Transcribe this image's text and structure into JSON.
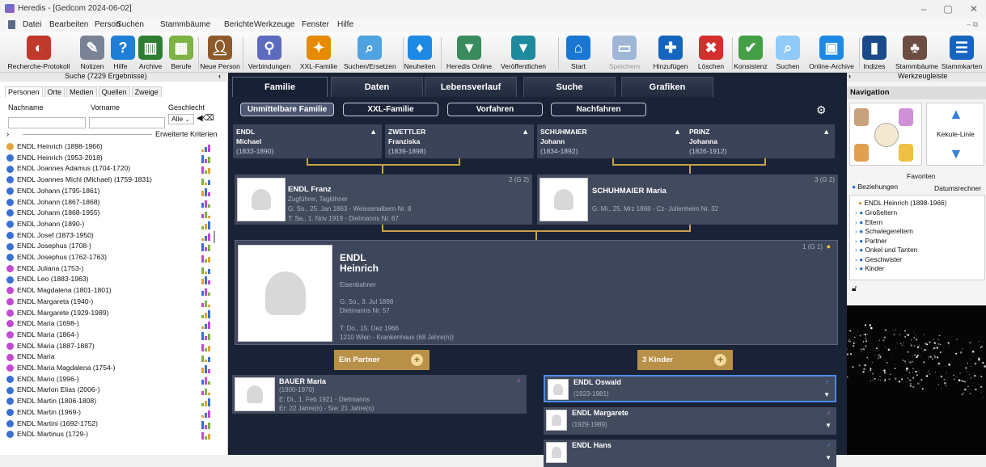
{
  "window": {
    "title": "Heredis - [Gedcom 2024-06-02]"
  },
  "menu": [
    "Datei",
    "Bearbeiten",
    "Person",
    "Suchen",
    "Stammbäume",
    "Berichte",
    "Werkzeuge",
    "Fenster",
    "Hilfe"
  ],
  "toolbar": [
    {
      "label": "Recherche-Protokoll",
      "icon": "research-log-icon",
      "color": "#c0392b"
    },
    {
      "label": "Notizen",
      "icon": "notes-icon",
      "color": "#7a8296"
    },
    {
      "label": "Hilfe",
      "icon": "help-icon",
      "color": "#1f7fd6"
    },
    {
      "label": "Archive",
      "icon": "archive-icon",
      "color": "#2e7d32"
    },
    {
      "label": "Berufe",
      "icon": "professions-icon",
      "color": "#7cb342"
    },
    {
      "label": "Neue Person",
      "icon": "new-person-icon",
      "color": "#8d5a2b"
    },
    {
      "label": "Verbindungen",
      "icon": "connections-icon",
      "color": "#5c6bc0"
    },
    {
      "label": "XXL-Familie",
      "icon": "xxl-family-icon",
      "color": "#e68a00"
    },
    {
      "label": "Suchen/Ersetzen",
      "icon": "search-replace-icon",
      "color": "#4fa3e0"
    },
    {
      "label": "Neuheiten",
      "icon": "news-icon",
      "color": "#1e88e5"
    },
    {
      "label": "Heredis Online",
      "icon": "heredis-online-icon",
      "color": "#3a8b5e"
    },
    {
      "label": "Veröffentlichen",
      "icon": "publish-icon",
      "color": "#1f8a9e"
    },
    {
      "label": "Start",
      "icon": "home-icon",
      "color": "#1976d2"
    },
    {
      "label": "Speichern",
      "icon": "save-icon",
      "color": "#9fb7d6"
    },
    {
      "label": "Hinzufügen",
      "icon": "add-icon",
      "color": "#1565c0"
    },
    {
      "label": "Löschen",
      "icon": "delete-icon",
      "color": "#d32f2f"
    },
    {
      "label": "Konsistenz",
      "icon": "consistency-icon",
      "color": "#43a047"
    },
    {
      "label": "Suchen",
      "icon": "search-icon",
      "color": "#90caf9"
    },
    {
      "label": "Online-Archive",
      "icon": "online-archives-icon",
      "color": "#1e88e5"
    },
    {
      "label": "Indizes",
      "icon": "indexes-icon",
      "color": "#1a4a8a"
    },
    {
      "label": "Stammbäume",
      "icon": "family-tree-icon",
      "color": "#6d4c41"
    },
    {
      "label": "Stammkarten",
      "icon": "family-cards-icon",
      "color": "#1565c0"
    }
  ],
  "subbar": {
    "search_result": "Suche (7229 Ergebnisse)",
    "toolbox": "Werkzeugleiste"
  },
  "leftpanel": {
    "tabs": [
      "Personen",
      "Orte",
      "Medien",
      "Quellen",
      "Zweige"
    ],
    "labels": {
      "lastname": "Nachname",
      "firstname": "Vorname",
      "gender": "Geschlecht",
      "gender_value": "Alle",
      "advanced": "Erweiterte Kriterien"
    },
    "persons": [
      {
        "name": "ENDL Heinrich (1898-1966)",
        "g": "m",
        "sel": true
      },
      {
        "name": "ENDL Heinrich (1953-2018)",
        "g": "m"
      },
      {
        "name": "ENDL Joannes Adamus (1704-1720)",
        "g": "m"
      },
      {
        "name": "ENDL Joannes Michl (Michael) (1759-1831)",
        "g": "m"
      },
      {
        "name": "ENDL Johann (1795-1861)",
        "g": "m"
      },
      {
        "name": "ENDL Johann (1867-1868)",
        "g": "m"
      },
      {
        "name": "ENDL Johann (1868-1955)",
        "g": "m"
      },
      {
        "name": "ENDL Johann (1890-)",
        "g": "m"
      },
      {
        "name": "ENDL Josef (1873-1950)",
        "g": "m"
      },
      {
        "name": "ENDL Josephus (1708-)",
        "g": "m"
      },
      {
        "name": "ENDL Josephus (1762-1763)",
        "g": "m"
      },
      {
        "name": "ENDL Juliana (1753-)",
        "g": "f"
      },
      {
        "name": "ENDL Leo (1883-1963)",
        "g": "m"
      },
      {
        "name": "ENDL Magdalena (1801-1801)",
        "g": "f"
      },
      {
        "name": "ENDL Margareta (1940-)",
        "g": "f"
      },
      {
        "name": "ENDL Margarete (1929-1989)",
        "g": "f"
      },
      {
        "name": "ENDL Maria (1698-)",
        "g": "f"
      },
      {
        "name": "ENDL Maria (1864-)",
        "g": "f"
      },
      {
        "name": "ENDL Maria (1887-1887)",
        "g": "f"
      },
      {
        "name": "ENDL Maria",
        "g": "f"
      },
      {
        "name": "ENDL Maria Magdalena (1754-)",
        "g": "f"
      },
      {
        "name": "ENDL Mario (1996-)",
        "g": "m"
      },
      {
        "name": "ENDL Marlon Elias (2006-)",
        "g": "m"
      },
      {
        "name": "ENDL Martin (1806-1808)",
        "g": "m"
      },
      {
        "name": "ENDL Martin (1969-)",
        "g": "m"
      },
      {
        "name": "ENDL Martini (1692-1752)",
        "g": "m"
      },
      {
        "name": "ENDL Martinus (1729-)",
        "g": "m"
      }
    ]
  },
  "main": {
    "tabs": [
      "Familie",
      "Daten",
      "Lebensverlauf",
      "Suche",
      "Grafiken"
    ],
    "pills": [
      "Unmittelbare Familie",
      "XXL-Familie",
      "Vorfahren",
      "Nachfahren"
    ],
    "ancestors": [
      {
        "surname": "ENDL",
        "given": "Michael",
        "years": "(1833-1890)"
      },
      {
        "surname": "ZWETTLER",
        "given": "Franziska",
        "years": "(1839-1898)"
      },
      {
        "surname": "SCHUHMAIER",
        "given": "Johann",
        "years": "(1834-1892)"
      },
      {
        "surname": "PRINZ",
        "given": "Johanna",
        "years": "(1826-1912)"
      }
    ],
    "father": {
      "name": "ENDL Franz",
      "badge": "2 (G 2)",
      "job": "Zugführer, Taglöhner",
      "birth": "G: So., 25. Jan 1863 - Weissenalbern Nr. 8",
      "death": "T: Sa., 1. Nov 1919 - Dietmanns Nr. 67"
    },
    "mother": {
      "name": "SCHUHMAIER Maria",
      "badge": "3 (G 2)",
      "birth": "G: Mi., 25. Mrz 1868 - Cz- Julienheim Nr. 32"
    },
    "main_person": {
      "surname": "ENDL",
      "given": "Heinrich",
      "badge": "1 (G 1)",
      "job": "Eisenbahner",
      "birth1": "G: So., 3. Jul 1898",
      "birth2": "Dietmanns Nr. 57",
      "death1": "T: Do., 15. Dez 1966",
      "death2": "1210 Wien - Krankenhaus (68 Jahre(n))"
    },
    "partner_btn": "Ein Partner",
    "children_btn": "3 Kinder",
    "partner": {
      "name": "BAUER Maria",
      "years": "(1900-1970)",
      "marriage": "E: Di., 1. Feb 1921 - Dietmanns",
      "ages": "Er: 22 Jahre(n) - Sie: 21 Jahre(n)"
    },
    "children": [
      {
        "name": "ENDL Oswald",
        "years": "(1923-1981)",
        "g": "m"
      },
      {
        "name": "ENDL Margarete",
        "years": "(1929-1989)",
        "g": "f"
      },
      {
        "name": "ENDL Hans",
        "years": "",
        "g": "m"
      }
    ]
  },
  "rightpanel": {
    "title": "Navigation",
    "kekule": "Kekule-Linie",
    "favoriten": "Favoriten",
    "tab1": "Beziehungen",
    "tab2": "Datumsrechner",
    "root": "ENDL Heinrich (1898-1966)",
    "items": [
      "Großeltern",
      "Eltern",
      "Schwiegereltern",
      "Partner",
      "Onkel und Tanten",
      "Geschwister",
      "Kinder"
    ]
  },
  "colors": {
    "male": "#3b6fd0",
    "female": "#c04ad0",
    "gold": "#b89048",
    "dark": "#1a2236"
  }
}
